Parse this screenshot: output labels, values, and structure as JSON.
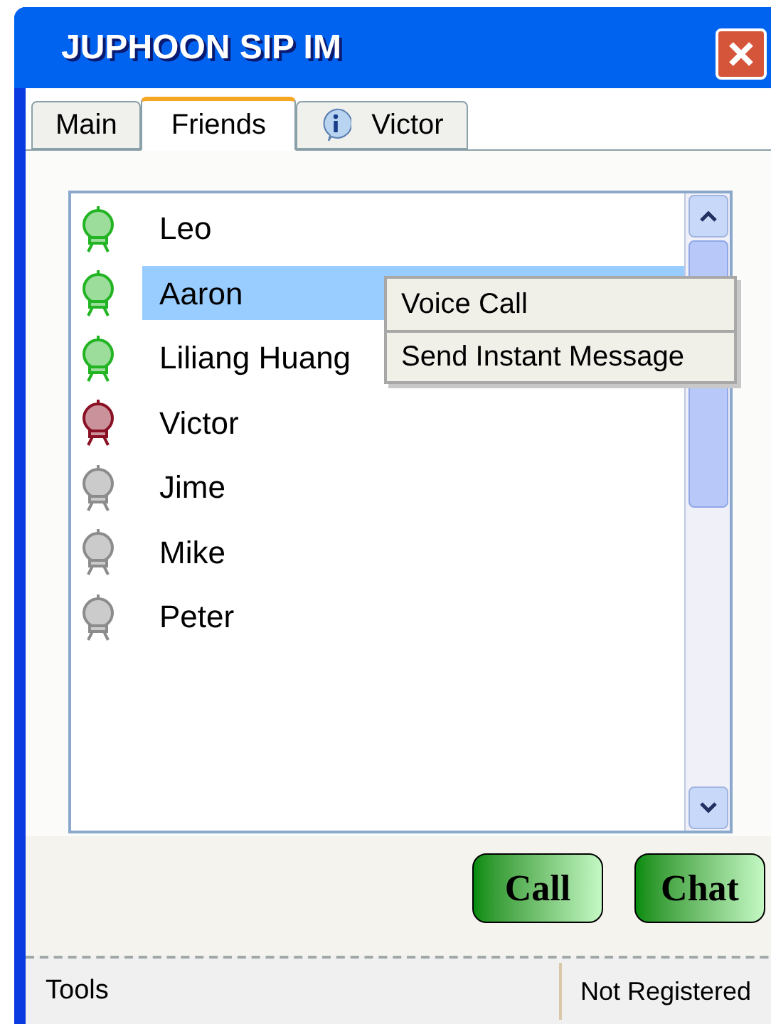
{
  "window": {
    "title": "JUPHOON SIP IM"
  },
  "tabs": [
    {
      "label": "Main",
      "selected": false,
      "kind": "plain"
    },
    {
      "label": "Friends",
      "selected": true,
      "kind": "plain"
    },
    {
      "label": "Victor",
      "selected": false,
      "kind": "info"
    }
  ],
  "friends": [
    {
      "name": "Leo",
      "color": "#22b422",
      "selected": false
    },
    {
      "name": "Aaron",
      "color": "#22b422",
      "selected": true
    },
    {
      "name": "Liliang Huang",
      "color": "#22b422",
      "selected": false
    },
    {
      "name": "Victor",
      "color": "#8a1024",
      "selected": false
    },
    {
      "name": "Jime",
      "color": "#8c8c8c",
      "selected": false
    },
    {
      "name": "Mike",
      "color": "#8c8c8c",
      "selected": false
    },
    {
      "name": "Peter",
      "color": "#8c8c8c",
      "selected": false
    }
  ],
  "context_menu": [
    "Voice Call",
    "Send Instant Message"
  ],
  "buttons": [
    "Call",
    "Chat"
  ],
  "status_bar": {
    "left": "Tools",
    "right": "Not Registered"
  }
}
